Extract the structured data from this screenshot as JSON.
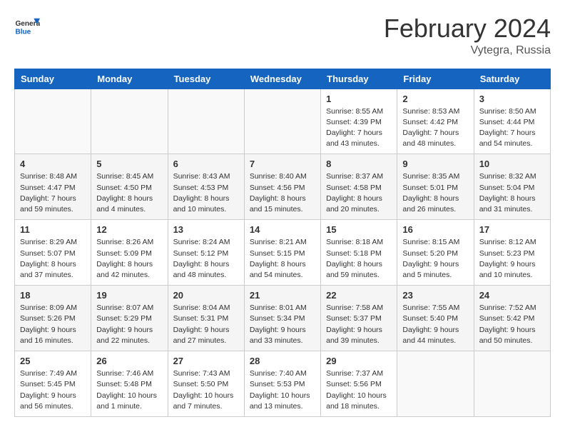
{
  "header": {
    "logo_line1": "General",
    "logo_line2": "Blue",
    "title": "February 2024",
    "subtitle": "Vytegra, Russia"
  },
  "columns": [
    "Sunday",
    "Monday",
    "Tuesday",
    "Wednesday",
    "Thursday",
    "Friday",
    "Saturday"
  ],
  "weeks": [
    [
      {
        "day": "",
        "info": ""
      },
      {
        "day": "",
        "info": ""
      },
      {
        "day": "",
        "info": ""
      },
      {
        "day": "",
        "info": ""
      },
      {
        "day": "1",
        "info": "Sunrise: 8:55 AM\nSunset: 4:39 PM\nDaylight: 7 hours\nand 43 minutes."
      },
      {
        "day": "2",
        "info": "Sunrise: 8:53 AM\nSunset: 4:42 PM\nDaylight: 7 hours\nand 48 minutes."
      },
      {
        "day": "3",
        "info": "Sunrise: 8:50 AM\nSunset: 4:44 PM\nDaylight: 7 hours\nand 54 minutes."
      }
    ],
    [
      {
        "day": "4",
        "info": "Sunrise: 8:48 AM\nSunset: 4:47 PM\nDaylight: 7 hours\nand 59 minutes."
      },
      {
        "day": "5",
        "info": "Sunrise: 8:45 AM\nSunset: 4:50 PM\nDaylight: 8 hours\nand 4 minutes."
      },
      {
        "day": "6",
        "info": "Sunrise: 8:43 AM\nSunset: 4:53 PM\nDaylight: 8 hours\nand 10 minutes."
      },
      {
        "day": "7",
        "info": "Sunrise: 8:40 AM\nSunset: 4:56 PM\nDaylight: 8 hours\nand 15 minutes."
      },
      {
        "day": "8",
        "info": "Sunrise: 8:37 AM\nSunset: 4:58 PM\nDaylight: 8 hours\nand 20 minutes."
      },
      {
        "day": "9",
        "info": "Sunrise: 8:35 AM\nSunset: 5:01 PM\nDaylight: 8 hours\nand 26 minutes."
      },
      {
        "day": "10",
        "info": "Sunrise: 8:32 AM\nSunset: 5:04 PM\nDaylight: 8 hours\nand 31 minutes."
      }
    ],
    [
      {
        "day": "11",
        "info": "Sunrise: 8:29 AM\nSunset: 5:07 PM\nDaylight: 8 hours\nand 37 minutes."
      },
      {
        "day": "12",
        "info": "Sunrise: 8:26 AM\nSunset: 5:09 PM\nDaylight: 8 hours\nand 42 minutes."
      },
      {
        "day": "13",
        "info": "Sunrise: 8:24 AM\nSunset: 5:12 PM\nDaylight: 8 hours\nand 48 minutes."
      },
      {
        "day": "14",
        "info": "Sunrise: 8:21 AM\nSunset: 5:15 PM\nDaylight: 8 hours\nand 54 minutes."
      },
      {
        "day": "15",
        "info": "Sunrise: 8:18 AM\nSunset: 5:18 PM\nDaylight: 8 hours\nand 59 minutes."
      },
      {
        "day": "16",
        "info": "Sunrise: 8:15 AM\nSunset: 5:20 PM\nDaylight: 9 hours\nand 5 minutes."
      },
      {
        "day": "17",
        "info": "Sunrise: 8:12 AM\nSunset: 5:23 PM\nDaylight: 9 hours\nand 10 minutes."
      }
    ],
    [
      {
        "day": "18",
        "info": "Sunrise: 8:09 AM\nSunset: 5:26 PM\nDaylight: 9 hours\nand 16 minutes."
      },
      {
        "day": "19",
        "info": "Sunrise: 8:07 AM\nSunset: 5:29 PM\nDaylight: 9 hours\nand 22 minutes."
      },
      {
        "day": "20",
        "info": "Sunrise: 8:04 AM\nSunset: 5:31 PM\nDaylight: 9 hours\nand 27 minutes."
      },
      {
        "day": "21",
        "info": "Sunrise: 8:01 AM\nSunset: 5:34 PM\nDaylight: 9 hours\nand 33 minutes."
      },
      {
        "day": "22",
        "info": "Sunrise: 7:58 AM\nSunset: 5:37 PM\nDaylight: 9 hours\nand 39 minutes."
      },
      {
        "day": "23",
        "info": "Sunrise: 7:55 AM\nSunset: 5:40 PM\nDaylight: 9 hours\nand 44 minutes."
      },
      {
        "day": "24",
        "info": "Sunrise: 7:52 AM\nSunset: 5:42 PM\nDaylight: 9 hours\nand 50 minutes."
      }
    ],
    [
      {
        "day": "25",
        "info": "Sunrise: 7:49 AM\nSunset: 5:45 PM\nDaylight: 9 hours\nand 56 minutes."
      },
      {
        "day": "26",
        "info": "Sunrise: 7:46 AM\nSunset: 5:48 PM\nDaylight: 10 hours\nand 1 minute."
      },
      {
        "day": "27",
        "info": "Sunrise: 7:43 AM\nSunset: 5:50 PM\nDaylight: 10 hours\nand 7 minutes."
      },
      {
        "day": "28",
        "info": "Sunrise: 7:40 AM\nSunset: 5:53 PM\nDaylight: 10 hours\nand 13 minutes."
      },
      {
        "day": "29",
        "info": "Sunrise: 7:37 AM\nSunset: 5:56 PM\nDaylight: 10 hours\nand 18 minutes."
      },
      {
        "day": "",
        "info": ""
      },
      {
        "day": "",
        "info": ""
      }
    ]
  ]
}
